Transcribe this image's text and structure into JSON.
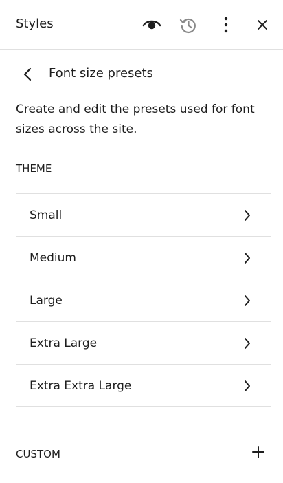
{
  "header": {
    "title": "Styles",
    "icons": [
      "eye-icon",
      "history-icon",
      "more-vertical-icon",
      "close-icon"
    ]
  },
  "nav": {
    "back_icon": "chevron-left-icon",
    "title": "Font size presets"
  },
  "description": "Create and edit the presets used for font sizes across the site.",
  "theme": {
    "label": "THEME",
    "items": [
      {
        "label": "Small"
      },
      {
        "label": "Medium"
      },
      {
        "label": "Large"
      },
      {
        "label": "Extra Large"
      },
      {
        "label": "Extra Extra Large"
      }
    ]
  },
  "custom": {
    "label": "CUSTOM",
    "add_icon": "plus-icon"
  }
}
